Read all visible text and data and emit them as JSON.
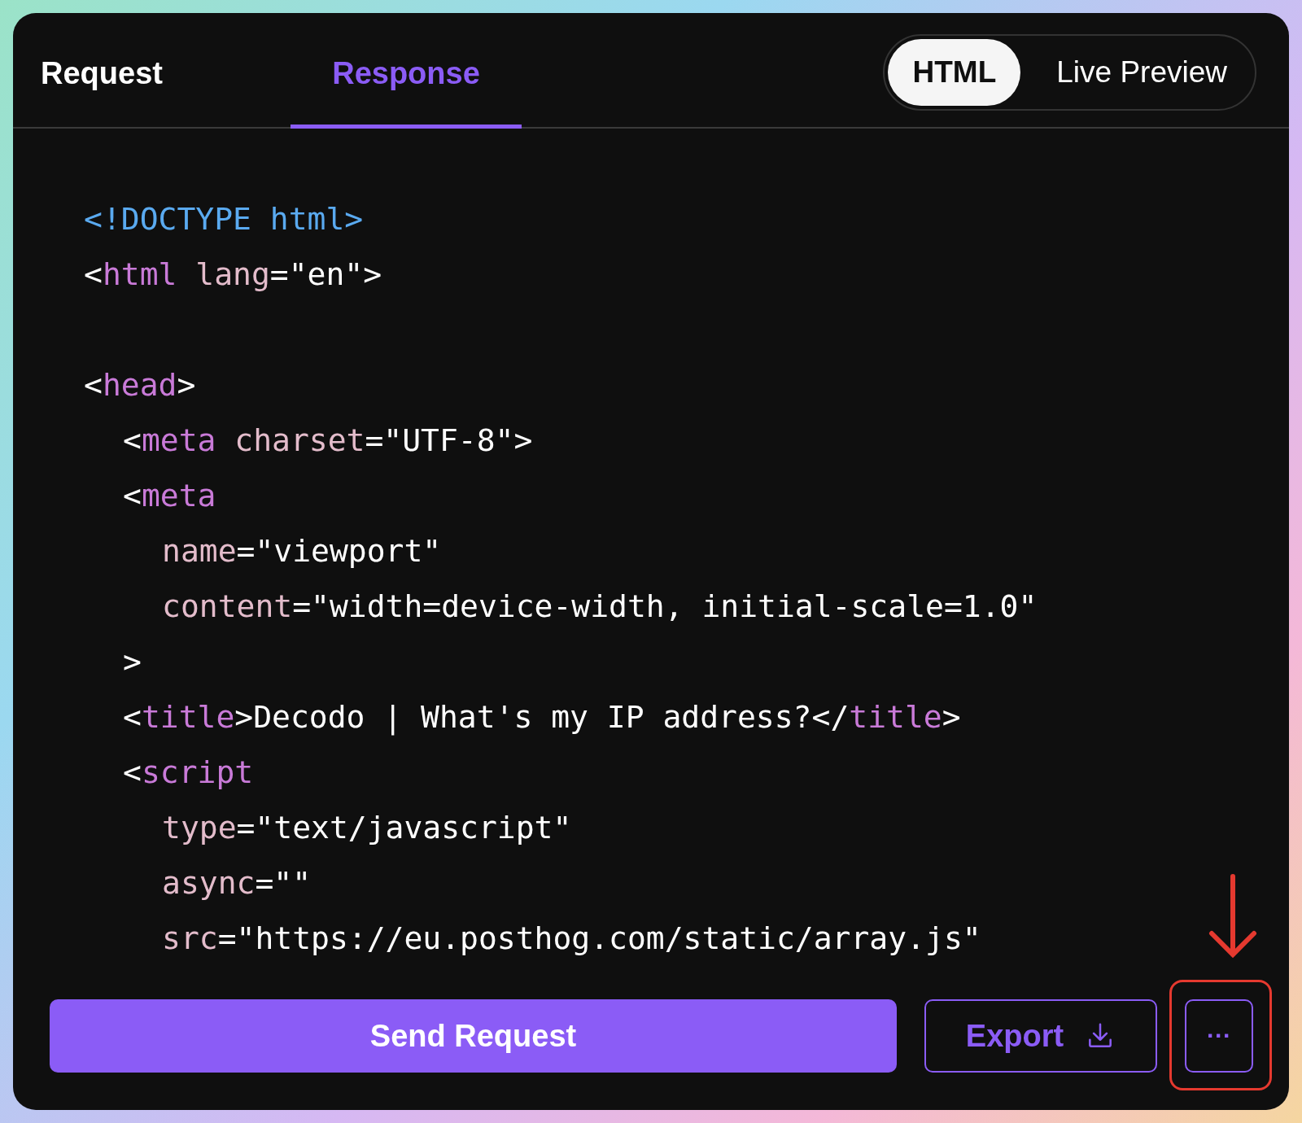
{
  "tabs": [
    {
      "label": "Request",
      "selected": false
    },
    {
      "label": "Response",
      "selected": true
    }
  ],
  "view_toggle": [
    {
      "label": "HTML",
      "selected": true
    },
    {
      "label": "Live Preview",
      "selected": false
    }
  ],
  "code": [
    {
      "kind": "code",
      "tokens": [
        {
          "text": "<!DOCTYPE html>",
          "kind": "doctype"
        }
      ]
    },
    {
      "kind": "code",
      "tokens": [
        {
          "text": "<",
          "kind": "punct"
        },
        {
          "text": "html",
          "kind": "tag"
        },
        {
          "text": " lang",
          "kind": "attr"
        },
        {
          "text": "=\"en\">",
          "kind": "punct"
        }
      ]
    },
    {
      "kind": "blank"
    },
    {
      "kind": "code",
      "tokens": [
        {
          "text": "<",
          "kind": "punct"
        },
        {
          "text": "head",
          "kind": "tag"
        },
        {
          "text": ">",
          "kind": "punct"
        }
      ],
      "children": [
        {
          "kind": "code",
          "tokens": [
            {
              "text": "<",
              "kind": "punct"
            },
            {
              "text": "meta",
              "kind": "tag"
            },
            {
              "text": " charset",
              "kind": "attr"
            },
            {
              "text": "=\"UTF-8\">",
              "kind": "punct"
            }
          ]
        },
        {
          "kind": "code",
          "tokens": [
            {
              "text": "<",
              "kind": "punct"
            },
            {
              "text": "meta",
              "kind": "tag"
            }
          ],
          "children": [
            {
              "kind": "code",
              "tokens": [
                {
                  "text": "name",
                  "kind": "attr"
                },
                {
                  "text": "=\"viewport\"",
                  "kind": "punct"
                }
              ]
            },
            {
              "kind": "code",
              "tokens": [
                {
                  "text": "content",
                  "kind": "attr"
                },
                {
                  "text": "=\"width=device-width, initial-scale=1.0\"",
                  "kind": "punct"
                }
              ]
            }
          ]
        },
        {
          "kind": "code",
          "tokens": [
            {
              "text": ">",
              "kind": "punct"
            }
          ]
        },
        {
          "kind": "code",
          "tokens": [
            {
              "text": "<",
              "kind": "punct"
            },
            {
              "text": "title",
              "kind": "tag"
            },
            {
              "text": ">Decodo | What's my IP address?</",
              "kind": "punct"
            },
            {
              "text": "title",
              "kind": "tag"
            },
            {
              "text": ">",
              "kind": "punct"
            }
          ]
        },
        {
          "kind": "code",
          "tokens": [
            {
              "text": "<",
              "kind": "punct"
            },
            {
              "text": "script",
              "kind": "tag"
            }
          ],
          "children": [
            {
              "kind": "code",
              "tokens": [
                {
                  "text": "type",
                  "kind": "attr"
                },
                {
                  "text": "=\"text/javascript\"",
                  "kind": "punct"
                }
              ]
            },
            {
              "kind": "code",
              "tokens": [
                {
                  "text": "async",
                  "kind": "attr"
                },
                {
                  "text": "=\"\"",
                  "kind": "punct"
                }
              ]
            },
            {
              "kind": "code",
              "tokens": [
                {
                  "text": "src",
                  "kind": "attr"
                },
                {
                  "text": "=\"https://eu.posthog.com/static/array.js\"",
                  "kind": "punct"
                }
              ]
            }
          ]
        }
      ]
    }
  ],
  "actions": {
    "send": "Send Request",
    "export": "Export",
    "more": "···"
  }
}
